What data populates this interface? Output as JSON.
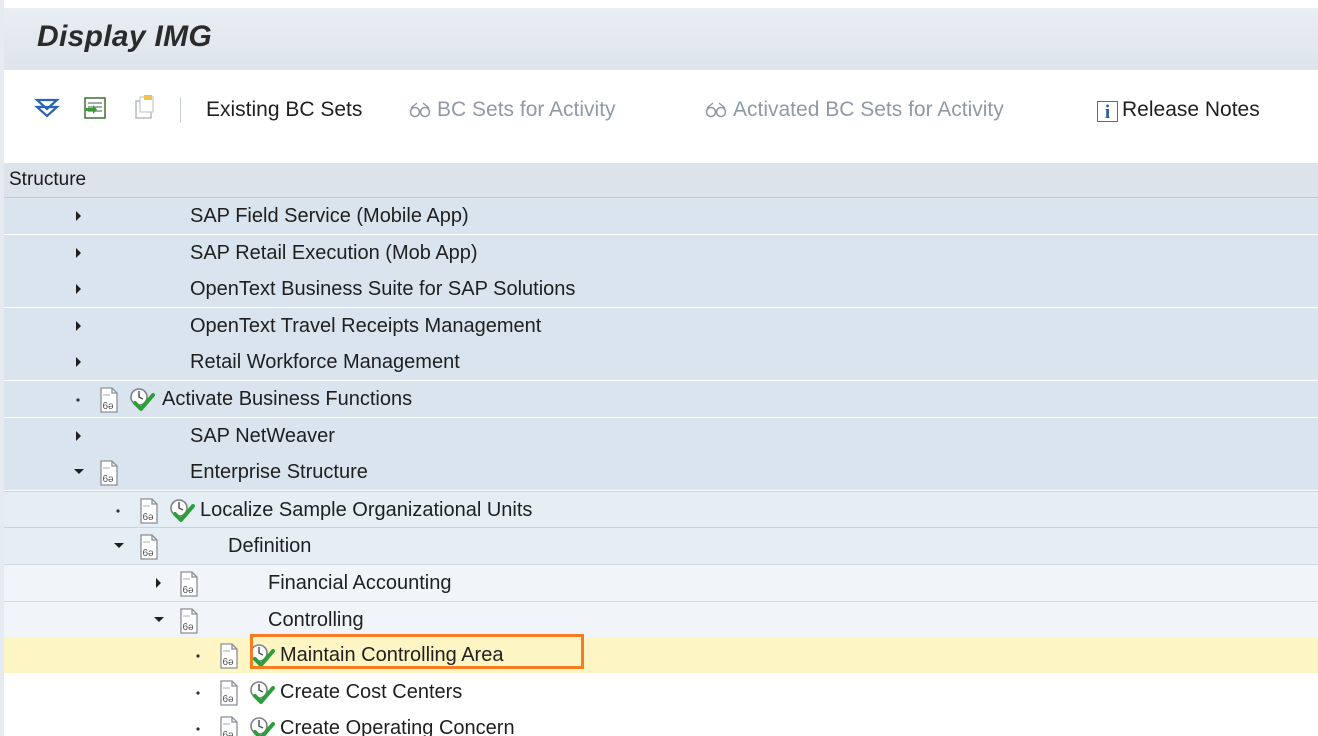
{
  "window": {
    "title": "Display IMG"
  },
  "toolbar": {
    "icons": [
      "expand-all-icon",
      "import-icon",
      "document-icon"
    ],
    "existing_bc_sets": "Existing BC Sets",
    "bc_sets_for_activity": "BC Sets for Activity",
    "activated_bc_sets_for_activity": "Activated BC Sets for Activity",
    "release_notes": "Release Notes"
  },
  "structure": {
    "header": "Structure",
    "rows": [
      {
        "label": "SAP Field Service (Mobile App)",
        "level": 0,
        "node": "expand"
      },
      {
        "label": "SAP Retail Execution (Mob App)",
        "level": 0,
        "node": "expand"
      },
      {
        "label": "OpenText Business Suite for SAP Solutions",
        "level": 0,
        "node": "expand"
      },
      {
        "label": "OpenText Travel Receipts Management",
        "level": 0,
        "node": "expand"
      },
      {
        "label": "Retail Workforce Management",
        "level": 0,
        "node": "expand"
      },
      {
        "label": "Activate Business Functions",
        "level": 0,
        "node": "leaf"
      },
      {
        "label": "SAP NetWeaver",
        "level": 0,
        "node": "expand"
      },
      {
        "label": "Enterprise Structure",
        "level": 0,
        "node": "collapse"
      },
      {
        "label": "Localize Sample Organizational Units",
        "level": 1,
        "node": "leaf"
      },
      {
        "label": "Definition",
        "level": 1,
        "node": "collapse"
      },
      {
        "label": "Financial Accounting",
        "level": 2,
        "node": "expand"
      },
      {
        "label": "Controlling",
        "level": 2,
        "node": "collapse"
      },
      {
        "label": "Maintain Controlling Area",
        "level": 3,
        "node": "leaf",
        "selected": true
      },
      {
        "label": "Create Cost Centers",
        "level": 3,
        "node": "leaf"
      },
      {
        "label": "Create Operating Concern",
        "level": 3,
        "node": "leaf"
      }
    ]
  },
  "colors": {
    "highlight": "#f57c22",
    "selected_row": "#fdf5c4",
    "check": "#2e9e3a"
  }
}
